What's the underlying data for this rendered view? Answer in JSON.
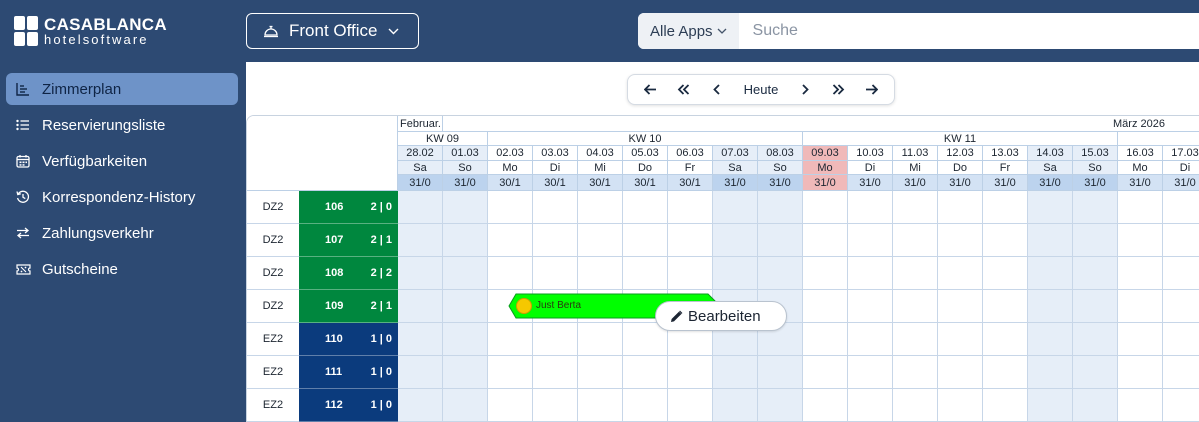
{
  "header": {
    "logo_line1": "CASABLANCA",
    "logo_line2": "hotelsoftware",
    "module_label": "Front Office",
    "apps_label": "Alle Apps",
    "search_placeholder": "Suche"
  },
  "sidebar": {
    "items": [
      {
        "label": "Zimmerplan",
        "icon": "chart-icon",
        "active": true
      },
      {
        "label": "Reservierungsliste",
        "icon": "list-icon",
        "active": false
      },
      {
        "label": "Verfügbarkeiten",
        "icon": "calendar-icon",
        "active": false
      },
      {
        "label": "Korrespondenz-History",
        "icon": "history-icon",
        "active": false
      },
      {
        "label": "Zahlungsverkehr",
        "icon": "transfer-icon",
        "active": false
      },
      {
        "label": "Gutscheine",
        "icon": "voucher-icon",
        "active": false
      }
    ]
  },
  "datenav": {
    "today_label": "Heute"
  },
  "calendar": {
    "months": [
      {
        "label": "Februar..."
      },
      {
        "label": "März 2026"
      }
    ],
    "weeks": [
      "KW 09",
      "KW 10",
      "KW 11"
    ],
    "days": [
      {
        "date": "28.02",
        "dow": "Sa",
        "util": "31/0",
        "weekend": true
      },
      {
        "date": "01.03",
        "dow": "So",
        "util": "31/0",
        "weekend": true
      },
      {
        "date": "02.03",
        "dow": "Mo",
        "util": "30/1",
        "weekend": false
      },
      {
        "date": "03.03",
        "dow": "Di",
        "util": "30/1",
        "weekend": false
      },
      {
        "date": "04.03",
        "dow": "Mi",
        "util": "30/1",
        "weekend": false
      },
      {
        "date": "05.03",
        "dow": "Do",
        "util": "30/1",
        "weekend": false
      },
      {
        "date": "06.03",
        "dow": "Fr",
        "util": "30/1",
        "weekend": false
      },
      {
        "date": "07.03",
        "dow": "Sa",
        "util": "31/0",
        "weekend": true
      },
      {
        "date": "08.03",
        "dow": "So",
        "util": "31/0",
        "weekend": true
      },
      {
        "date": "09.03",
        "dow": "Mo",
        "util": "31/0",
        "weekend": false,
        "today": true
      },
      {
        "date": "10.03",
        "dow": "Di",
        "util": "31/0",
        "weekend": false
      },
      {
        "date": "11.03",
        "dow": "Mi",
        "util": "31/0",
        "weekend": false
      },
      {
        "date": "12.03",
        "dow": "Do",
        "util": "31/0",
        "weekend": false
      },
      {
        "date": "13.03",
        "dow": "Fr",
        "util": "31/0",
        "weekend": false
      },
      {
        "date": "14.03",
        "dow": "Sa",
        "util": "31/0",
        "weekend": true
      },
      {
        "date": "15.03",
        "dow": "So",
        "util": "31/0",
        "weekend": true
      },
      {
        "date": "16.03",
        "dow": "Mo",
        "util": "31/0",
        "weekend": false
      },
      {
        "date": "17.03",
        "dow": "Di",
        "util": "31/0",
        "weekend": false
      }
    ],
    "rooms": [
      {
        "category": "DZ2",
        "number": "106",
        "occupancy": "2 | 0",
        "color": "#00873e"
      },
      {
        "category": "DZ2",
        "number": "107",
        "occupancy": "2 | 1",
        "color": "#00873e"
      },
      {
        "category": "DZ2",
        "number": "108",
        "occupancy": "2 | 2",
        "color": "#00873e"
      },
      {
        "category": "DZ2",
        "number": "109",
        "occupancy": "2 | 1",
        "color": "#00873e"
      },
      {
        "category": "EZ2",
        "number": "110",
        "occupancy": "1 | 0",
        "color": "#0b3b7d"
      },
      {
        "category": "EZ2",
        "number": "111",
        "occupancy": "1 | 0",
        "color": "#0b3b7d"
      },
      {
        "category": "EZ2",
        "number": "112",
        "occupancy": "1 | 0",
        "color": "#0b3b7d"
      }
    ],
    "booking": {
      "guest": "Just Berta",
      "color": "#00ff00"
    },
    "edit_label": "Bearbeiten"
  }
}
